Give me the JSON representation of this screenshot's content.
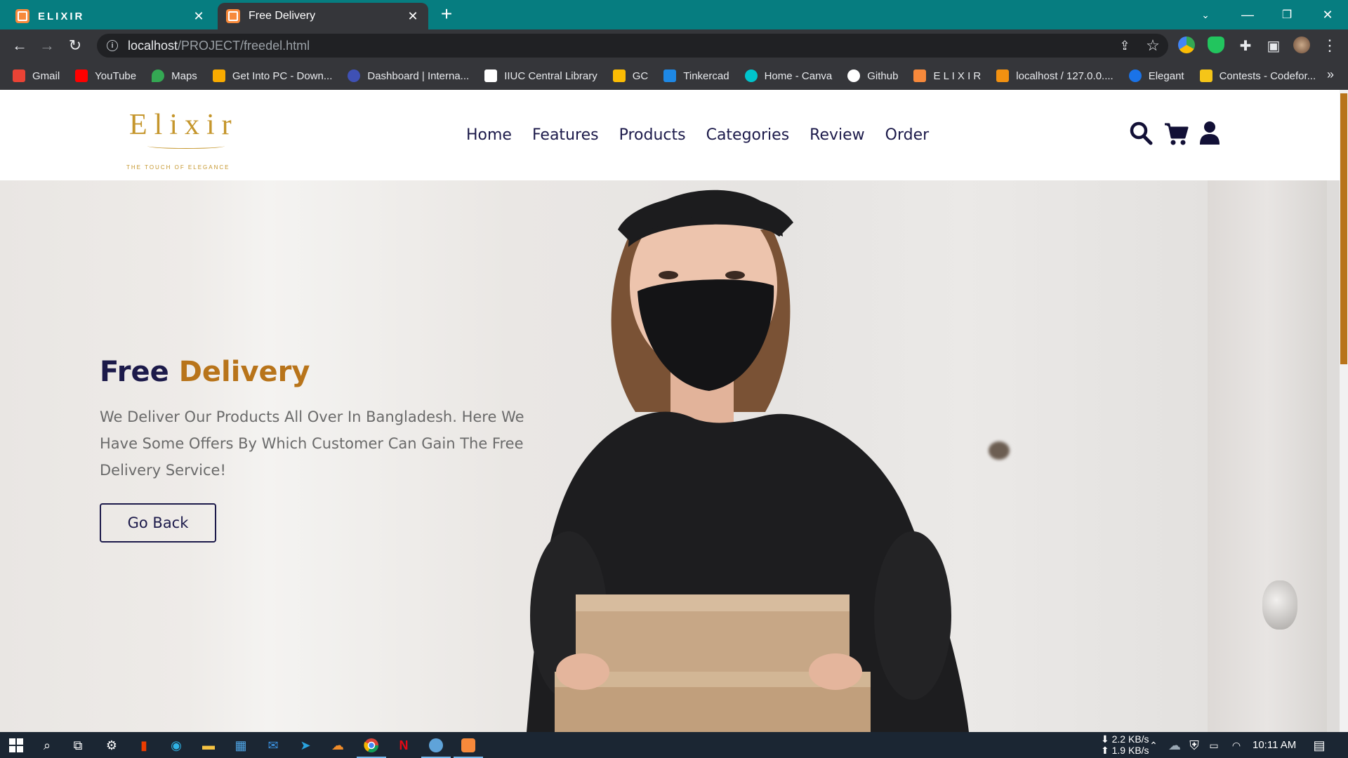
{
  "browser": {
    "tabs": [
      {
        "title": "ELIXIR",
        "favicon": "xampp-icon"
      },
      {
        "title": "Free Delivery",
        "favicon": "xampp-icon"
      }
    ],
    "address": {
      "host": "localhost",
      "path": "/PROJECT/freedel.html"
    }
  },
  "bookmarks": [
    {
      "label": "Gmail",
      "icon": "gmail-icon",
      "color": "#ea4335"
    },
    {
      "label": "YouTube",
      "icon": "youtube-icon",
      "color": "#ff0000"
    },
    {
      "label": "Maps",
      "icon": "maps-icon",
      "color": "#34a853"
    },
    {
      "label": "Get Into PC - Down...",
      "icon": "getintopc-icon",
      "color": "#f9ab00"
    },
    {
      "label": "Dashboard | Interna...",
      "icon": "dashboard-icon",
      "color": "#3f51b5"
    },
    {
      "label": "IIUC Central Library",
      "icon": "library-icon",
      "color": "#ffffff"
    },
    {
      "label": "GC",
      "icon": "classroom-icon",
      "color": "#fbbc04"
    },
    {
      "label": "Tinkercad",
      "icon": "tinkercad-icon",
      "color": "#1e88e5"
    },
    {
      "label": "Home - Canva",
      "icon": "canva-icon",
      "color": "#00c4cc"
    },
    {
      "label": "Github",
      "icon": "github-icon",
      "color": "#ffffff"
    },
    {
      "label": "E L I X I R",
      "icon": "xampp-icon",
      "color": "#f7893b"
    },
    {
      "label": "localhost / 127.0.0....",
      "icon": "phpmyadmin-icon",
      "color": "#f29111"
    },
    {
      "label": "Elegant",
      "icon": "elegant-icon",
      "color": "#1a73e8"
    },
    {
      "label": "Contests - Codefor...",
      "icon": "codeforces-icon",
      "color": "#f5c518"
    }
  ],
  "site": {
    "logo": {
      "word": "Elixir",
      "tagline": "THE TOUCH OF ELEGANCE"
    },
    "nav": [
      "Home",
      "Features",
      "Products",
      "Categories",
      "Review",
      "Order"
    ],
    "hero": {
      "title_main": "Free",
      "title_accent": "Delivery",
      "text": "We Deliver Our Products All Over In Bangladesh. Here We Have Some Offers By Which Customer Can Gain The Free Delivery Service!",
      "button": "Go Back"
    },
    "colors": {
      "accent": "#b8741a",
      "primary": "#1c1a4a"
    }
  },
  "taskbar": {
    "net_down": "2.2 KB/s",
    "net_up": "1.9 KB/s",
    "time": "10:11 AM"
  }
}
